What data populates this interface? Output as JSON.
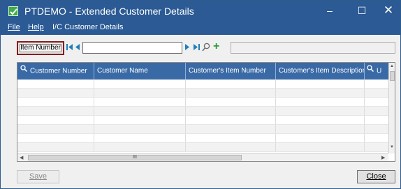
{
  "window": {
    "title": "PTDEMO - Extended Customer Details",
    "controls": {
      "minimize": "–",
      "maximize": "☐",
      "close": "✕"
    }
  },
  "menu": {
    "file": "File",
    "help": "Help",
    "ic_details": "I/C Customer Details"
  },
  "toolbar": {
    "key_field_label": "Item Number",
    "key_value": "",
    "add_symbol": "+",
    "description": ""
  },
  "grid": {
    "columns": [
      "Customer Number",
      "Customer Name",
      "Customer's Item Number",
      "Customer's Item Description",
      "U"
    ],
    "rows": [],
    "hscroll_grip": "III"
  },
  "footer": {
    "save_label": "Save",
    "close_label": "Close"
  },
  "colors": {
    "chrome": "#2b5a94",
    "grid_header": "#3a6aa6",
    "highlight_border": "#8b1b1b",
    "add_icon": "#2e9a3a",
    "nav_arrows": "#1f7fb8"
  }
}
